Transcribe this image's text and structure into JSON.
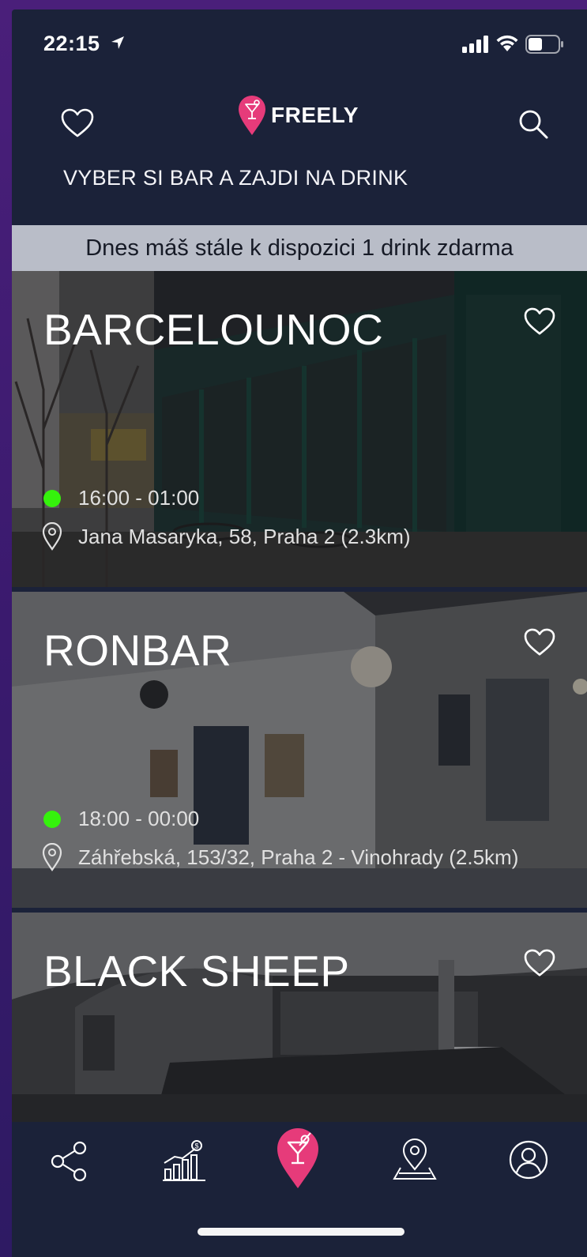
{
  "status_bar": {
    "time": "22:15"
  },
  "header": {
    "app_name": "FREELY",
    "tagline": "VYBER SI BAR A ZAJDI NA DRINK"
  },
  "promo": {
    "text": "Dnes máš stále k dispozici 1 drink zdarma"
  },
  "bars": [
    {
      "name": "BARCELOUNOC",
      "hours": "16:00 - 01:00",
      "address": "Jana Masaryka, 58, Praha 2 (2.3km)",
      "open": true
    },
    {
      "name": "RONBAR",
      "hours": "18:00 - 00:00",
      "address": "Záhřebská, 153/32, Praha 2 - Vinohrady (2.5km)",
      "open": true
    },
    {
      "name": "BLACK SHEEP"
    }
  ],
  "tab_bar": {
    "items": [
      "share-icon",
      "stats-icon",
      "drink-pin-icon",
      "map-icon",
      "profile-icon"
    ],
    "active": "drink-pin-icon"
  },
  "colors": {
    "background": "#1b2239",
    "accent": "#e63b7a",
    "open": "#35f20c",
    "banner": "#b9bdc8"
  }
}
